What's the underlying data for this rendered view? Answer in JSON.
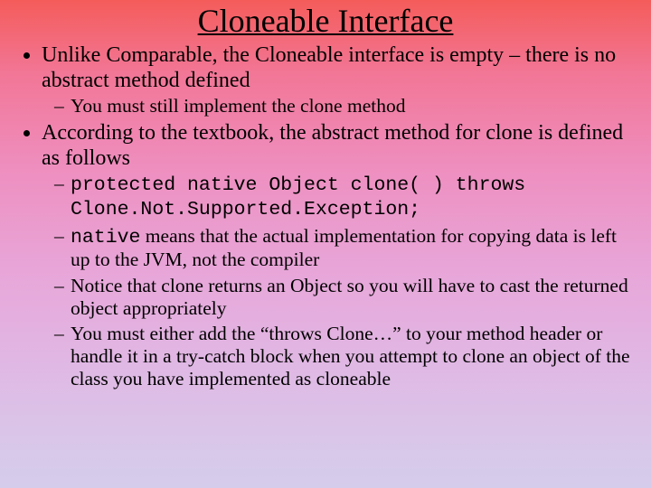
{
  "title": "Cloneable Interface",
  "bullets": [
    {
      "text": "Unlike Comparable, the Cloneable interface is empty – there is no abstract method defined",
      "subs": [
        {
          "text": "You must still implement the clone method"
        }
      ]
    },
    {
      "text": "According to the textbook, the abstract method for clone is defined as follows",
      "subs": [
        {
          "code": "protected native Object clone( ) throws Clone.Not.Supported.Exception;"
        },
        {
          "pre_code": "native",
          "post": " means that the actual implementation for copying data is left up to the JVM, not the compiler"
        },
        {
          "text": "Notice that clone returns an Object so you will have to cast the returned object appropriately"
        },
        {
          "text": "You must either add the “throws Clone…” to your method header or handle it in a try-catch block when you attempt to clone an object of the class you have implemented as cloneable"
        }
      ]
    }
  ]
}
